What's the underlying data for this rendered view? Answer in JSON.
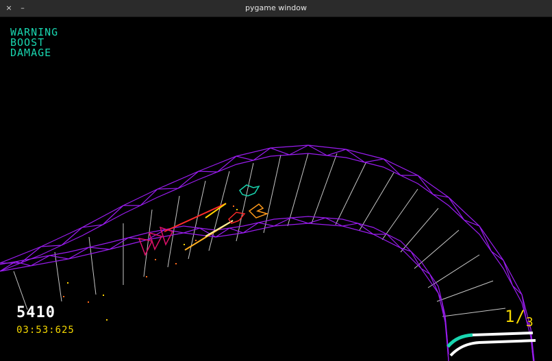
{
  "window": {
    "title": "pygame window",
    "close_label": "×",
    "minimize_label": "–"
  },
  "hud": {
    "status_messages": [
      "WARNING",
      "BOOST",
      "DAMAGE"
    ],
    "score": "5410",
    "timer": "03:53:625",
    "lap_current": "1",
    "lap_separator": "/",
    "lap_total": "3"
  },
  "colors": {
    "track_edge": "#9a1cf0",
    "track_rung": "#c8c8c8",
    "status_text": "#19d6b0",
    "timer_text": "#f5d800",
    "score_text": "#ffffff",
    "player_ship": "#e0106a",
    "rival_red": "#ff2a2a",
    "rival_orange": "#ff9a1a",
    "rival_teal": "#19d6b0"
  }
}
